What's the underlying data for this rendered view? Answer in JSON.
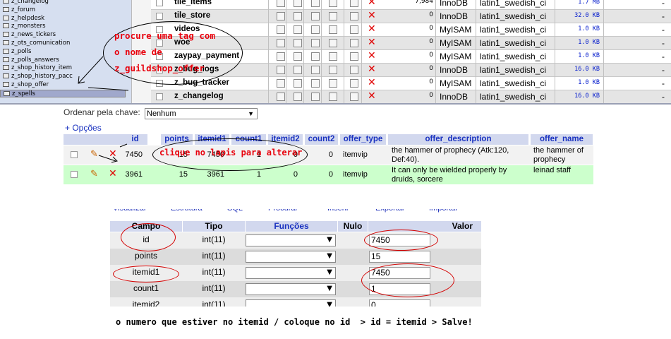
{
  "sidebar": {
    "tables": [
      "z_changelog",
      "z_forum",
      "z_helpdesk",
      "z_monsters",
      "z_news_tickers",
      "z_ots_comunication",
      "z_polls",
      "z_polls_answers",
      "z_shop_history_item",
      "z_shop_history_pacc",
      "z_shop_offer",
      "z_spells"
    ],
    "selected": "z_spells"
  },
  "top_table": {
    "rows": [
      {
        "name": "tile_items",
        "rows": "7,984",
        "engine": "InnoDB",
        "collation": "latin1_swedish_ci",
        "size": "1.7 MB",
        "overhead": "-"
      },
      {
        "name": "tile_store",
        "rows": "0",
        "engine": "InnoDB",
        "collation": "latin1_swedish_ci",
        "size": "32.0 KB",
        "overhead": "-"
      },
      {
        "name": "videos",
        "rows": "0",
        "engine": "MyISAM",
        "collation": "latin1_swedish_ci",
        "size": "1.0 KB",
        "overhead": "-"
      },
      {
        "name": "woe",
        "rows": "0",
        "engine": "MyISAM",
        "collation": "latin1_swedish_ci",
        "size": "1.0 KB",
        "overhead": "-"
      },
      {
        "name": "zaypay_payment",
        "rows": "0",
        "engine": "MyISAM",
        "collation": "latin1_swedish_ci",
        "size": "1.0 KB",
        "overhead": "-"
      },
      {
        "name": "z_bug_logs",
        "rows": "0",
        "engine": "InnoDB",
        "collation": "latin1_swedish_ci",
        "size": "16.0 KB",
        "overhead": "-"
      },
      {
        "name": "z_bug_tracker",
        "rows": "0",
        "engine": "MyISAM",
        "collation": "latin1_swedish_ci",
        "size": "1.0 KB",
        "overhead": "-"
      },
      {
        "name": "z_changelog",
        "rows": "0",
        "engine": "InnoDB",
        "collation": "latin1_swedish_ci",
        "size": "16.0 KB",
        "overhead": "-"
      }
    ]
  },
  "annotations": {
    "note1": [
      "procure uma tag com",
      "o nome de",
      "z_guildshop_offer"
    ],
    "note2": "clique no lapis para alterar",
    "note3": "o numero que estiver no itemid / coloque no id  > id = itemid > Salve!"
  },
  "browse": {
    "sort_label": "Ordenar pela chave:",
    "sort_value": "Nenhum",
    "options_link": "+ Opções",
    "columns": [
      "id",
      "points",
      "itemid1",
      "count1",
      "itemid2",
      "count2",
      "offer_type",
      "offer_description",
      "offer_name"
    ],
    "rows": [
      {
        "id": "7450",
        "points": "15",
        "itemid1": "7450",
        "count1": "1",
        "itemid2": "0",
        "count2": "0",
        "offer_type": "itemvip",
        "offer_description": [
          "the hammer of prophecy (Atk:120,",
          "Def:40)."
        ],
        "offer_name": [
          "the hammer of",
          "prophecy"
        ]
      },
      {
        "id": "3961",
        "points": "15",
        "itemid1": "3961",
        "count1": "1",
        "itemid2": "0",
        "count2": "0",
        "offer_type": "itemvip",
        "offer_description": [
          "It can only be wielded properly by",
          "druids, sorcere"
        ],
        "offer_name": [
          "leinad staff"
        ]
      }
    ]
  },
  "edit": {
    "tabs": [
      "Visualizar",
      "Estrutura",
      "SQL",
      "Procurar",
      "Inserir",
      "Exportar",
      "Importar"
    ],
    "headers": {
      "field": "Campo",
      "type": "Tipo",
      "functions": "Funções",
      "null": "Nulo",
      "value": "Valor"
    },
    "rows": [
      {
        "field": "id",
        "type": "int(11)",
        "value": "7450"
      },
      {
        "field": "points",
        "type": "int(11)",
        "value": "15"
      },
      {
        "field": "itemid1",
        "type": "int(11)",
        "value": "7450"
      },
      {
        "field": "count1",
        "type": "int(11)",
        "value": "1"
      },
      {
        "field": "itemid2",
        "type": "int(11)",
        "value": "0"
      }
    ]
  },
  "colors": {
    "red_note": "#e8000c",
    "header_bg": "#d2d8ee",
    "link_blue": "#1a32c0",
    "row_green": "#ccffcc"
  }
}
